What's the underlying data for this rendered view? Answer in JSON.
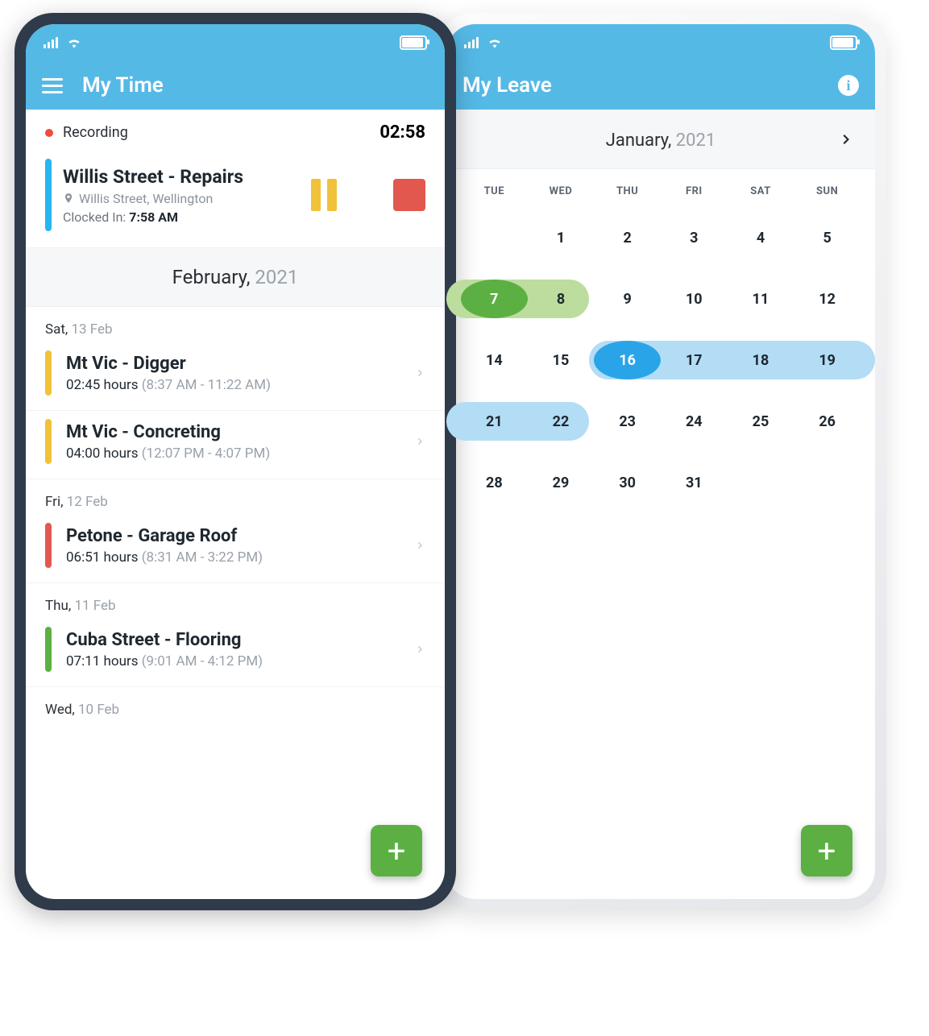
{
  "left_phone": {
    "appbar_title": "My Time",
    "recording": {
      "label": "Recording",
      "elapsed": "02:58"
    },
    "active": {
      "title": "Willis Street - Repairs",
      "location": "Willis Street, Wellington",
      "clocked_label": "Clocked In:",
      "clocked_time": "7:58 AM"
    },
    "month": {
      "name": "February,",
      "year": "2021"
    },
    "days": [
      {
        "dow": "Sat,",
        "date": "13 Feb",
        "entries": [
          {
            "color": "cb-yellow",
            "title": "Mt Vic - Digger",
            "hours": "02:45 hours",
            "range": "(8:37 AM - 11:22 AM)"
          },
          {
            "color": "cb-yellow",
            "title": "Mt Vic - Concreting",
            "hours": "04:00 hours",
            "range": "(12:07 PM - 4:07 PM)"
          }
        ]
      },
      {
        "dow": "Fri,",
        "date": "12 Feb",
        "entries": [
          {
            "color": "cb-red",
            "title": "Petone - Garage Roof",
            "hours": "06:51 hours",
            "range": "(8:31 AM - 3:22 PM)"
          }
        ]
      },
      {
        "dow": "Thu,",
        "date": "11 Feb",
        "entries": [
          {
            "color": "cb-green",
            "title": "Cuba Street - Flooring",
            "hours": "07:11 hours",
            "range": "(9:01 AM - 4:12 PM)"
          }
        ]
      },
      {
        "dow": "Wed,",
        "date": "10 Feb",
        "entries": []
      }
    ]
  },
  "right_phone": {
    "appbar_title": "My Leave",
    "month": {
      "name": "January,",
      "year": "2021"
    },
    "dow": [
      "TUE",
      "WED",
      "THU",
      "FRI",
      "SAT",
      "SUN"
    ],
    "cells": [
      "",
      "1",
      "2",
      "3",
      "4",
      "5",
      "7",
      "8",
      "9",
      "10",
      "11",
      "12",
      "14",
      "15",
      "16",
      "17",
      "18",
      "19",
      "21",
      "22",
      "23",
      "24",
      "25",
      "26",
      "28",
      "29",
      "30",
      "31",
      "",
      ""
    ],
    "highlights": {
      "green_range": {
        "row": 1,
        "startCol": 0,
        "endCol": 1,
        "pill": "#bcdd9e",
        "selectedCol": 0,
        "selectedBg": "#5cb043"
      },
      "blue_range_a": {
        "row": 2,
        "startCol": 2,
        "endCol": 5,
        "pill": "#b3dcf5",
        "selectedCol": 2,
        "selectedBg": "#2aa4e8"
      },
      "blue_range_b": {
        "row": 3,
        "startCol": 0,
        "endCol": 1,
        "pill": "#b3dcf5"
      }
    }
  },
  "fab_glyph": "+"
}
